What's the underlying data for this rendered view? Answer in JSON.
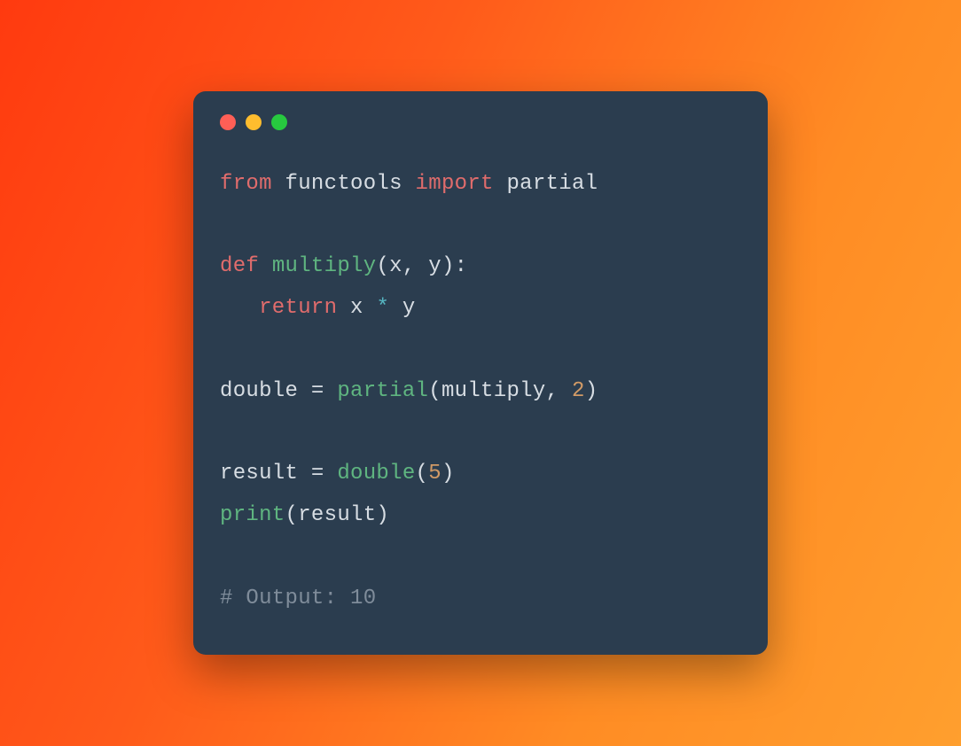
{
  "traffic_lights": {
    "close_color": "#ff5f56",
    "minimize_color": "#ffbd2e",
    "maximize_color": "#27c93f"
  },
  "code": {
    "l1_kw_from": "from",
    "l1_mod": " functools ",
    "l1_kw_import": "import",
    "l1_sym": " partial",
    "l3_kw_def": "def",
    "l3_sp1": " ",
    "l3_fn": "multiply",
    "l3_params": "(x, y):",
    "l4_indent": "   ",
    "l4_kw_return": "return",
    "l4_expr_a": " x ",
    "l4_op": "*",
    "l4_expr_b": " y",
    "l6_lhs": "double = ",
    "l6_fn": "partial",
    "l6_args_a": "(multiply, ",
    "l6_num": "2",
    "l6_args_b": ")",
    "l8_lhs": "result = ",
    "l8_fn": "double",
    "l8_args_a": "(",
    "l8_num": "5",
    "l8_args_b": ")",
    "l9_fn": "print",
    "l9_args": "(result)",
    "l11_cmt": "# Output: 10"
  }
}
